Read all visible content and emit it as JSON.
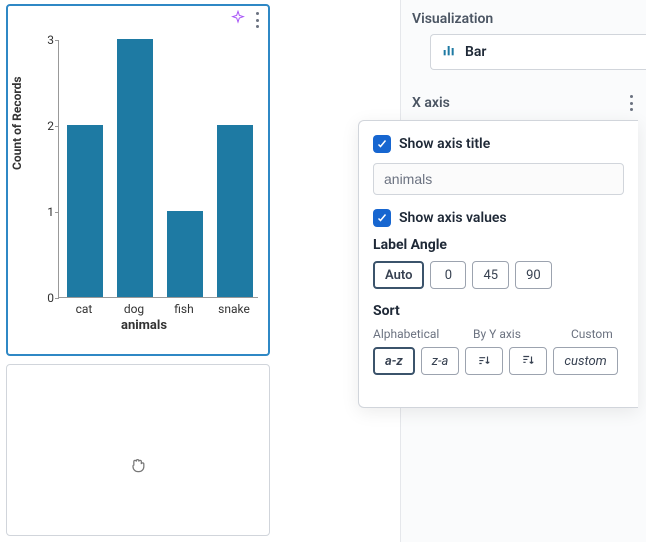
{
  "chart_data": {
    "type": "bar",
    "categories": [
      "cat",
      "dog",
      "fish",
      "snake"
    ],
    "values": [
      2,
      3,
      1,
      2
    ],
    "ylabel": "Count of Records",
    "xlabel": "animals",
    "yticks": [
      0,
      1,
      2,
      3
    ],
    "ylim": [
      0,
      3
    ]
  },
  "right": {
    "visualization_header": "Visualization",
    "visualization_value": "Bar",
    "xaxis_header": "X axis"
  },
  "panel": {
    "show_title_label": "Show axis title",
    "title_input_value": "animals",
    "show_values_label": "Show axis values",
    "label_angle_header": "Label Angle",
    "angles": {
      "auto": "Auto",
      "a0": "0",
      "a45": "45",
      "a90": "90"
    },
    "sort_header": "Sort",
    "sort_group_labels": {
      "alpha": "Alphabetical",
      "byy": "By Y axis",
      "custom": "Custom"
    },
    "sort_buttons": {
      "az": "a-z",
      "za": "z-a",
      "custom": "custom"
    }
  }
}
